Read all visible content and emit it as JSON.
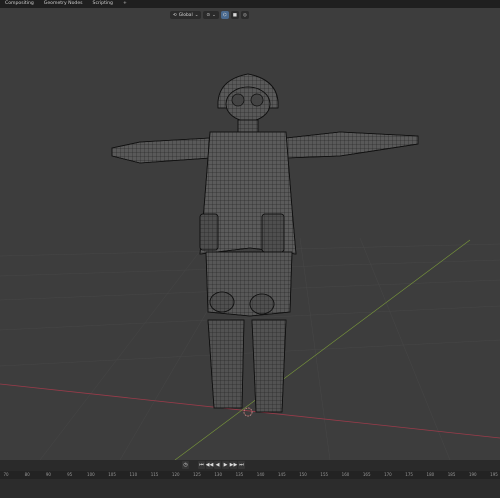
{
  "workspace_tabs": [
    "Compositing",
    "Geometry Nodes",
    "Scripting",
    "+"
  ],
  "viewport_header": {
    "orientation_label": "Global",
    "icons": [
      "transform-orientation-icon",
      "snap-icon",
      "proportional-edit-icon",
      "overlay-icon"
    ]
  },
  "viewport": {
    "background": "#3d3d3d",
    "object": "character mesh in wireframe edit view",
    "accent_colors": {
      "x_axis": "#9b3b4a",
      "y_axis": "#7a9a3a",
      "cursor": "#e0e0e0"
    }
  },
  "playback": {
    "buttons": [
      "◷",
      "⏮",
      "◀◀",
      "◀",
      "▶",
      "▶▶",
      "⏭"
    ]
  },
  "timeline_ruler": {
    "labels": [
      "70",
      "80",
      "90",
      "95",
      "100",
      "105",
      "110",
      "115",
      "120",
      "125",
      "130",
      "135",
      "140",
      "145",
      "150",
      "155",
      "160",
      "165",
      "170",
      "175",
      "180",
      "185",
      "190",
      "195"
    ]
  }
}
